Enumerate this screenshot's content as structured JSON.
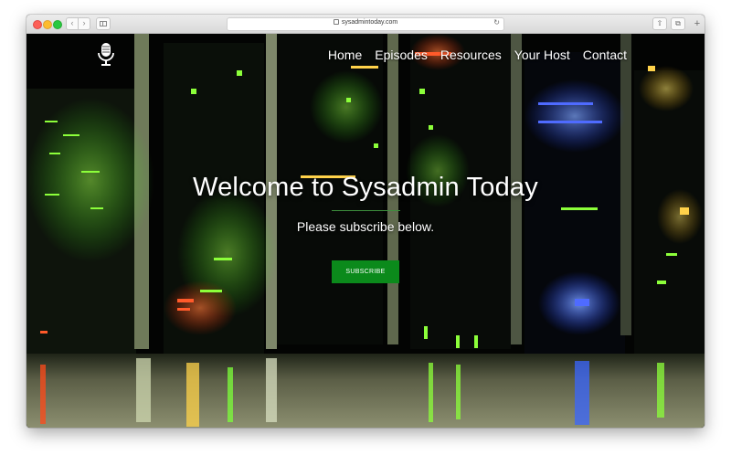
{
  "browser": {
    "url": "sysadmintoday.com",
    "back_glyph": "‹",
    "forward_glyph": "›",
    "reload_glyph": "↻",
    "share_glyph": "⇧",
    "tabs_glyph": "⧉",
    "newtab_glyph": "+"
  },
  "icons": {
    "logo": "microphone-icon",
    "lock": "lock-icon",
    "reload": "reload-icon",
    "share": "share-icon",
    "tabs": "tabs-overview-icon",
    "new_tab": "plus-icon",
    "sidebar": "sidebar-icon"
  },
  "nav": {
    "items": [
      {
        "label": "Home"
      },
      {
        "label": "Episodes"
      },
      {
        "label": "Resources"
      },
      {
        "label": "Your Host"
      },
      {
        "label": "Contact"
      }
    ]
  },
  "hero": {
    "title": "Welcome to Sysadmin Today",
    "subtitle": "Please subscribe below.",
    "button_label": "SUBSCRIBE"
  },
  "colors": {
    "button": "#0b8a1b",
    "text": "#ffffff"
  }
}
